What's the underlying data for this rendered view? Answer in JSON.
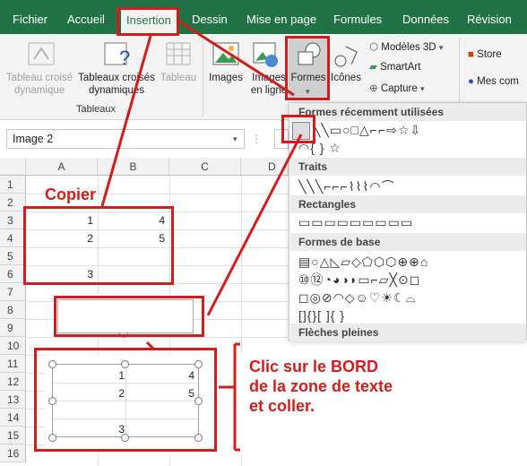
{
  "tabs": [
    "Fichier",
    "Accueil",
    "Insertion",
    "Dessin",
    "Mise en page",
    "Formules",
    "Données",
    "Révision"
  ],
  "ribbon": {
    "tableaux": [
      "Tableau croisé dynamique",
      "Tableaux croisés dynamiques",
      "Tableau"
    ],
    "group_label": "Tableaux",
    "images": "Images",
    "images_en_ligne": "Images en ligne",
    "formes": "Formes",
    "icones": "Icônes",
    "modeles3d": "Modèles 3D",
    "smartart": "SmartArt",
    "capture": "Capture",
    "store": "Store",
    "mes_complements": "Mes com"
  },
  "namebox": "Image 2",
  "formula_col": "D",
  "columns": [
    "A",
    "B",
    "C"
  ],
  "rows": [
    "1",
    "2",
    "3",
    "4",
    "5",
    "6",
    "7",
    "8",
    "9",
    "10",
    "11",
    "12",
    "13",
    "14",
    "15",
    "16"
  ],
  "cells": {
    "b3a": "1",
    "b3b": "4",
    "b4a": "2",
    "b4b": "5",
    "b6a": "3"
  },
  "textbox_cells": {
    "r1a": "1",
    "r1b": "4",
    "r2a": "2",
    "r2b": "5",
    "r3a": "3"
  },
  "shapes_panel": {
    "recent": "Formes récemment utilisées",
    "traits": "Traits",
    "rectangles": "Rectangles",
    "formes_base": "Formes de base",
    "fleches": "Flèches pleines",
    "row_recent1": "╲╲▭○□△⌐⌐⇨☆⇩",
    "row_recent2": "◠{ } ☆",
    "row_traits": "╲╲╲⌐⌐⌐⌇⌇⌇◠⌒",
    "row_rect": "▭▭▭▭▭▭▭▭▭",
    "row_base1": "▤○△◺▱◇⬠⬡⬡⊕⊕⌂",
    "row_base2": "⑩⑫◔◕◑◗▭⌐▱╳⊙◻",
    "row_base3": "◻◎⊘◠◇☺♡☀☾⌓",
    "row_base4": "[]{}[ ]{ }"
  },
  "annotations": {
    "copier": "Copier",
    "clic1": "Clic sur le BORD",
    "clic2": "de la zone de texte",
    "clic3": "et coller."
  },
  "colors": {
    "excel_green": "#217346",
    "annot_red": "#d01d1d"
  }
}
